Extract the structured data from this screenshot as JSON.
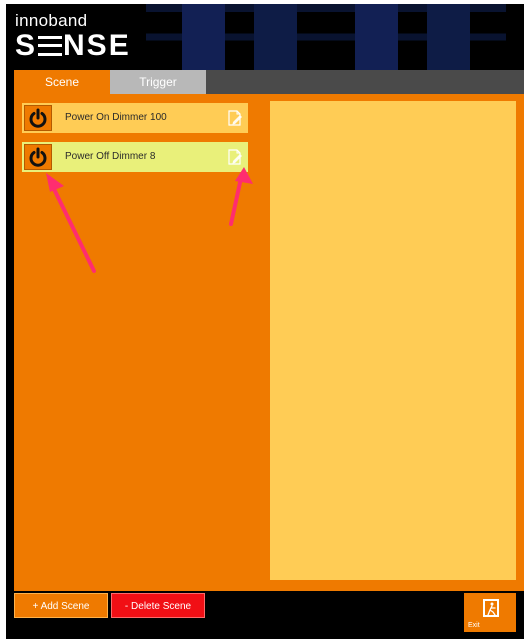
{
  "app": {
    "brand_top": "innoband",
    "brand_main_before": "S",
    "brand_main_after": "NSE"
  },
  "tabs": [
    {
      "label": "Scene",
      "active": true
    },
    {
      "label": "Trigger",
      "active": false
    }
  ],
  "scenes": [
    {
      "label": "Power On Dimmer 100",
      "selected": false
    },
    {
      "label": "Power Off Dimmer 8",
      "selected": true
    }
  ],
  "buttons": {
    "add_scene": "+ Add Scene",
    "delete_scene": "- Delete Scene",
    "exit": "Exit"
  },
  "icons": {
    "power": "power-icon",
    "edit": "edit-document-icon",
    "exit": "exit-door-icon"
  },
  "colors": {
    "orange": "#ef7a00",
    "panel_yellow": "#ffcc55",
    "selected_green": "#e9f07a",
    "delete_red": "#f10f15",
    "annotation_pink": "#ff2d6f"
  }
}
